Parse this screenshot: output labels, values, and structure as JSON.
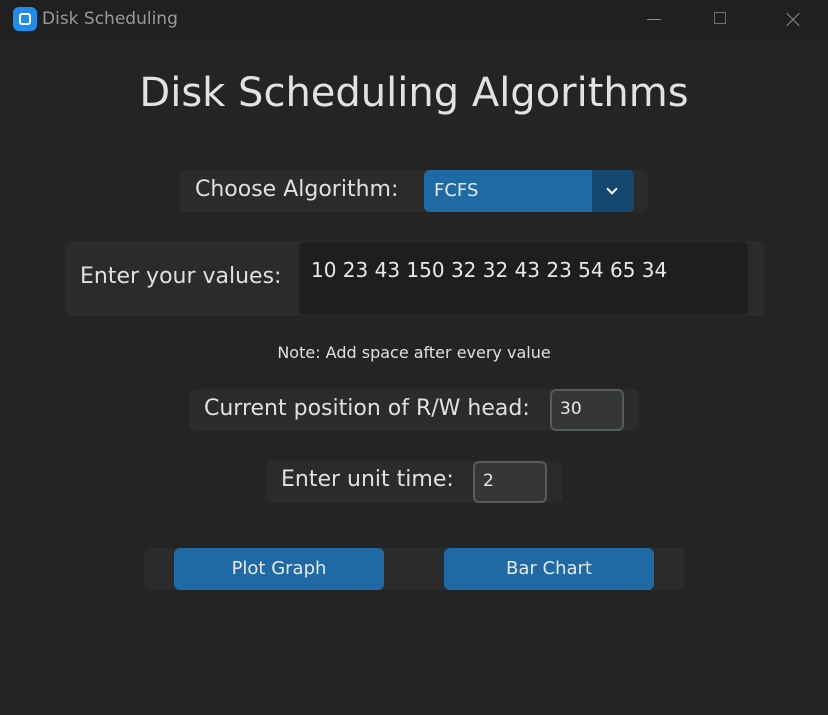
{
  "window": {
    "title": "Disk Scheduling"
  },
  "main": {
    "heading": "Disk Scheduling Algorithms",
    "algorithm": {
      "label": "Choose Algorithm:",
      "selected": "FCFS"
    },
    "values": {
      "label": "Enter your values:",
      "input": "10 23 43 150 32 32 43 23 54 65 34"
    },
    "note": "Note: Add space after every value",
    "head_position": {
      "label": "Current position of R/W head:",
      "value": "30"
    },
    "unit_time": {
      "label": "Enter unit time:",
      "value": "2"
    },
    "buttons": {
      "plot_graph": "Plot Graph",
      "bar_chart": "Bar Chart"
    }
  },
  "colors": {
    "accent": "#1f6aa5",
    "accent_dark": "#144870",
    "background": "#242424",
    "frame": "#2b2b2b"
  }
}
